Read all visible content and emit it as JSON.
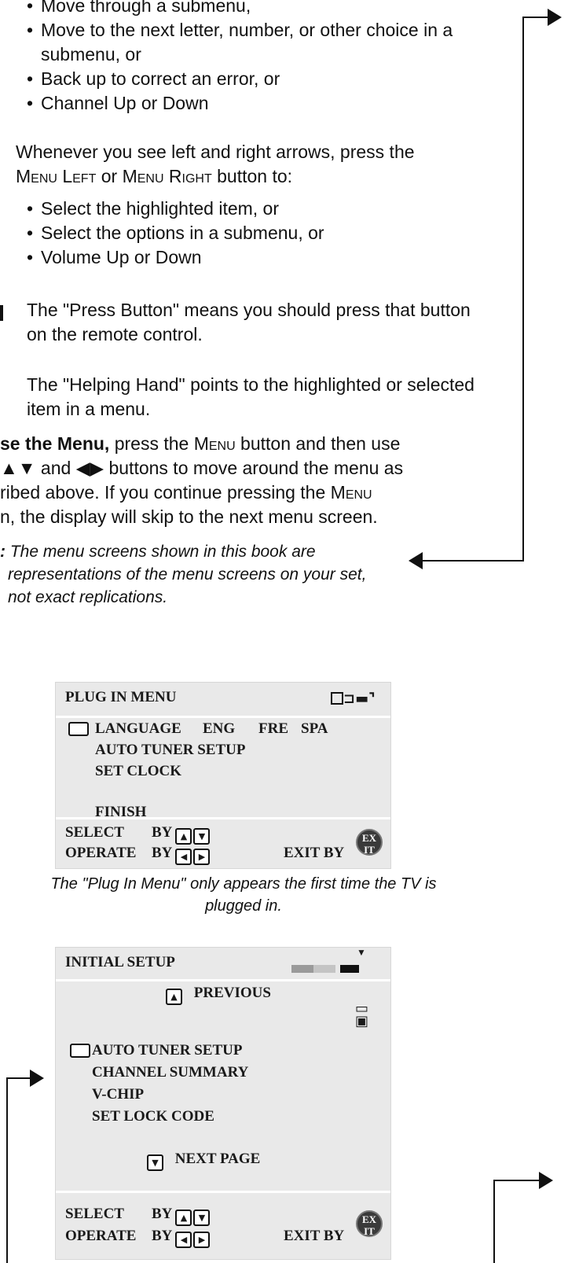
{
  "bullets_top": [
    "Move through a submenu,",
    "Move to the next letter, number, or other choice in a submenu, or",
    "Back up to correct an error, or",
    "Channel Up or Down"
  ],
  "lr_intro": {
    "pre": "Whenever you see left and right arrows, press the",
    "menu_left": "Menu Left",
    "or": "or",
    "menu_right": "Menu Right",
    "post": "button to:"
  },
  "bullets_lr": [
    "Select the highlighted item, or",
    "Select the options in a submenu, or",
    "Volume Up or Down"
  ],
  "press_button_text": "The \"Press Button\" means you should press that button on the remote control.",
  "helping_hand_text": "The \"Helping Hand\" points to the highlighted or selected item in a menu.",
  "use_menu": {
    "bold": "se the Menu,",
    "t1": "press the",
    "menu": "Menu",
    "t2": "button and then use",
    "updown_glyph": "▲▼",
    "t3": "and",
    "leftright_glyph": "◀▶",
    "t4": "buttons to move around the menu as",
    "line3a": "ribed above. If you continue pressing the",
    "line3b": "Menu",
    "line4": "n, the display will skip to the next menu screen."
  },
  "note": {
    "label": ":",
    "l1": "The menu screens shown in this book are",
    "l2": "representations of the menu screens on your set,",
    "l3": "not exact replications."
  },
  "plug_menu": {
    "title": "PLUG IN MENU",
    "items": [
      "LANGUAGE",
      "AUTO TUNER SETUP",
      "SET CLOCK",
      "FINISH"
    ],
    "lang_options": [
      "ENG",
      "FRE",
      "SPA"
    ],
    "select_label": "SELECT",
    "operate_label": "OPERATE",
    "by": "BY",
    "exit_by": "EXIT BY",
    "exit_l1": "EX",
    "exit_l2": "IT",
    "icon": "plug-icon"
  },
  "plug_caption": "The \"Plug In Menu\" only appears the first time the TV is plugged in.",
  "initial_setup": {
    "title": "INITIAL SETUP",
    "previous": "PREVIOUS",
    "items": [
      "AUTO TUNER SETUP",
      "CHANNEL SUMMARY",
      "V-CHIP",
      "SET LOCK CODE"
    ],
    "next_page": "NEXT PAGE",
    "select_label": "SELECT",
    "operate_label": "OPERATE",
    "by": "BY",
    "exit_by": "EXIT BY",
    "exit_l1": "EX",
    "exit_l2": "IT",
    "icon": "tv-lock-icon"
  }
}
